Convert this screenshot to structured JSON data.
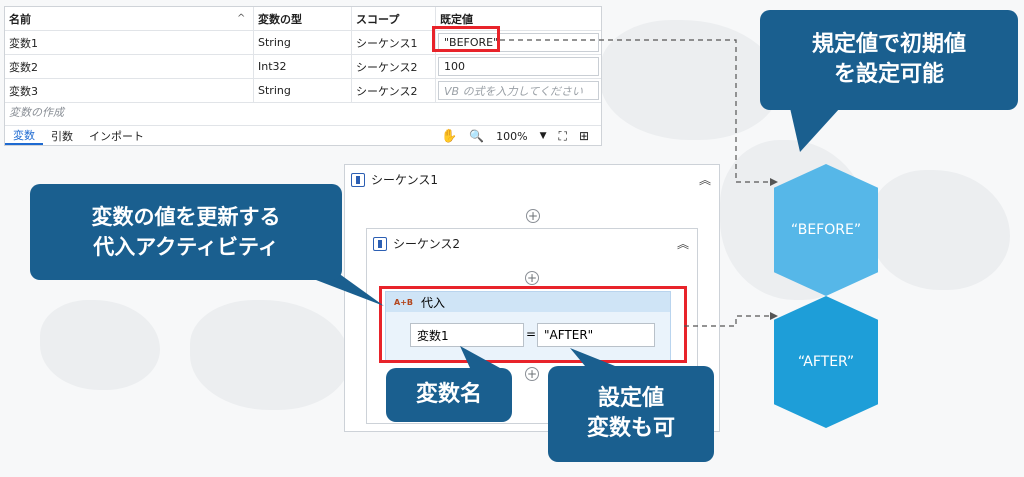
{
  "variables_panel": {
    "headers": {
      "name": "名前",
      "type": "変数の型",
      "scope": "スコープ",
      "default": "既定値"
    },
    "rows": [
      {
        "name": "変数1",
        "type": "String",
        "scope": "シーケンス1",
        "default": "\"BEFORE\""
      },
      {
        "name": "変数2",
        "type": "Int32",
        "scope": "シーケンス2",
        "default": "100"
      },
      {
        "name": "変数3",
        "type": "String",
        "scope": "シーケンス2",
        "default_placeholder": "VB の式を入力してください"
      }
    ],
    "create_variable": "変数の作成",
    "tabs": [
      "変数",
      "引数",
      "インポート"
    ],
    "zoom": "100%"
  },
  "designer": {
    "sequence1_title": "シーケンス1",
    "sequence2_title": "シーケンス2",
    "assign": {
      "icon_text": "A+B",
      "title": "代入",
      "to": "変数1",
      "equals": "=",
      "value": "\"AFTER\""
    }
  },
  "callouts": {
    "left_line1": "変数の値を更新する",
    "left_line2": "代入アクティビティ",
    "right_line1": "規定値で初期値",
    "right_line2": "を設定可能",
    "name_label": "変数名",
    "set_line1": "設定値",
    "set_line2": "変数も可"
  },
  "hexagons": {
    "before": "“BEFORE”",
    "after": "“AFTER”"
  },
  "colors": {
    "callout": "#1a5f8f",
    "highlight": "#e8232a",
    "hex_light": "#56b7e8",
    "hex_dark": "#1e9ed8"
  }
}
